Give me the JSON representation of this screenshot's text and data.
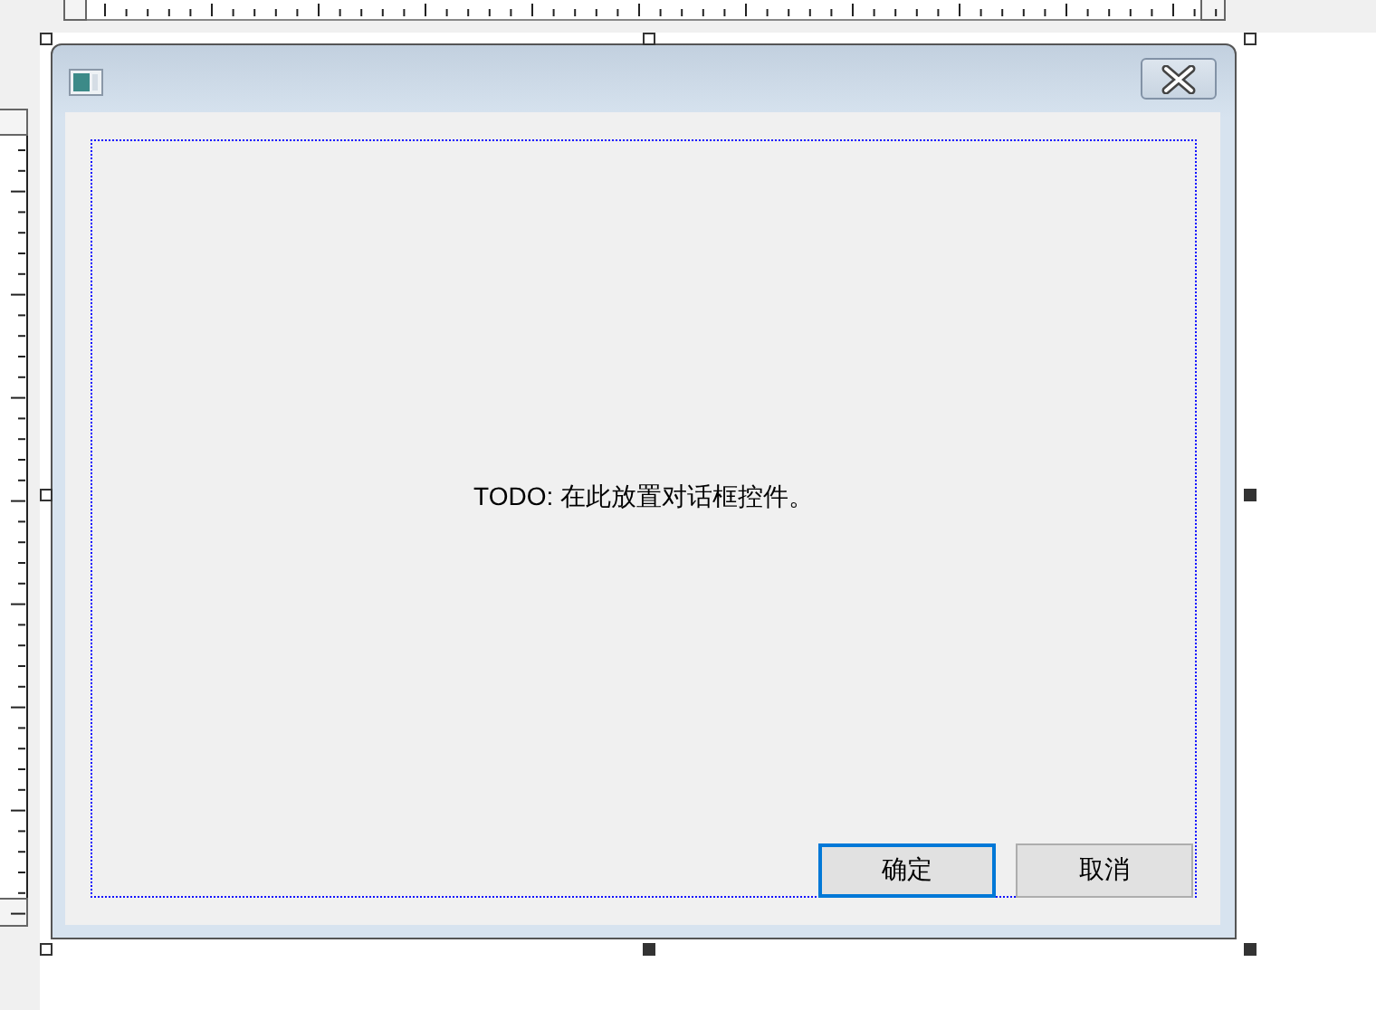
{
  "dialog": {
    "message": "TODO: 在此放置对话框控件。",
    "buttons": [
      {
        "label": "确定",
        "selected": true
      },
      {
        "label": "取消",
        "selected": false
      }
    ]
  }
}
